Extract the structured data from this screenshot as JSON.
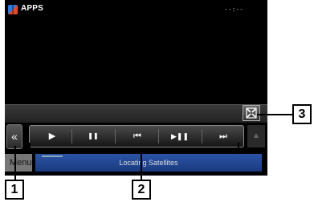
{
  "status_bar": {
    "title": "APPS",
    "clock": "--:--"
  },
  "controls": {
    "collapse": "«",
    "play": "▶",
    "pause": "❚❚",
    "previous": "⏮",
    "play_pause": "▶❚❚",
    "next": "⏭",
    "side": "▲"
  },
  "bottom_bar": {
    "menu_label": "Menu",
    "status_text": "Locating Satellites"
  },
  "callouts": {
    "one": "1",
    "two": "2",
    "three": "3"
  },
  "icons": {
    "apps": "apps-icon",
    "collapse": "double-chevron-left-icon",
    "play": "play-icon",
    "pause": "pause-icon",
    "previous": "skip-previous-icon",
    "play_pause": "play-pause-icon",
    "next": "skip-next-icon",
    "fullscreen": "fullscreen-icon"
  },
  "colors": {
    "screen": "#000000",
    "info_box": "#2b54a6",
    "control_bar": "#4a4a4a",
    "menu_button": "#777777"
  }
}
